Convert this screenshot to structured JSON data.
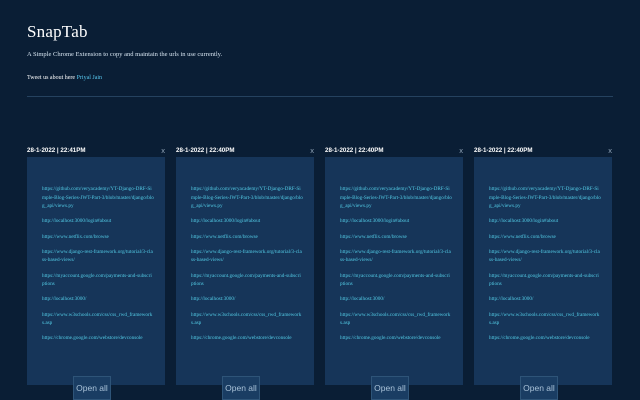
{
  "app": {
    "title": "SnapTab",
    "subtitle": "A Simple Chrome Extension to copy and maintain the urls in use currently.",
    "tweet_prefix": "Tweet us about here",
    "tweet_link": "Priyal Jain"
  },
  "colors": {
    "background": "#0a1e35",
    "card": "#163559",
    "link": "#53cce6"
  },
  "cards": [
    {
      "date": "28-1-2022 | 22:41PM",
      "close_label": "x",
      "open_all_label": "Open all",
      "urls": [
        "https://github.com/veryacademy/YT-Django-DRF-Simple-Blog-Series-JWT-Part-3/blob/master/django/blog_api/views.py",
        "http://localhost:3000/login#about",
        "https://www.netflix.com/browse",
        "https://www.django-rest-framework.org/tutorial/3-class-based-views/",
        "https://myaccount.google.com/payments-and-subscriptions",
        "http://localhost:3000/",
        "https://www.w3schools.com/css/css_rwd_frameworks.asp",
        "https://chrome.google.com/webstore/devconsole"
      ]
    },
    {
      "date": "28-1-2022 | 22:40PM",
      "close_label": "x",
      "open_all_label": "Open all",
      "urls": [
        "https://github.com/veryacademy/YT-Django-DRF-Simple-Blog-Series-JWT-Part-3/blob/master/django/blog_api/views.py",
        "http://localhost:3000/login#about",
        "https://www.netflix.com/browse",
        "https://www.django-rest-framework.org/tutorial/3-class-based-views/",
        "https://myaccount.google.com/payments-and-subscriptions",
        "http://localhost:3000/",
        "https://www.w3schools.com/css/css_rwd_frameworks.asp",
        "https://chrome.google.com/webstore/devconsole"
      ]
    },
    {
      "date": "28-1-2022 | 22:40PM",
      "close_label": "x",
      "open_all_label": "Open all",
      "urls": [
        "https://github.com/veryacademy/YT-Django-DRF-Simple-Blog-Series-JWT-Part-3/blob/master/django/blog_api/views.py",
        "http://localhost:3000/login#about",
        "https://www.netflix.com/browse",
        "https://www.django-rest-framework.org/tutorial/3-class-based-views/",
        "https://myaccount.google.com/payments-and-subscriptions",
        "http://localhost:3000/",
        "https://www.w3schools.com/css/css_rwd_frameworks.asp",
        "https://chrome.google.com/webstore/devconsole"
      ]
    },
    {
      "date": "28-1-2022 | 22:40PM",
      "close_label": "x",
      "open_all_label": "Open all",
      "urls": [
        "https://github.com/veryacademy/YT-Django-DRF-Simple-Blog-Series-JWT-Part-3/blob/master/django/blog_api/views.py",
        "http://localhost:3000/login#about",
        "https://www.netflix.com/browse",
        "https://www.django-rest-framework.org/tutorial/3-class-based-views/",
        "https://myaccount.google.com/payments-and-subscriptions",
        "http://localhost:3000/",
        "https://www.w3schools.com/css/css_rwd_frameworks.asp",
        "https://chrome.google.com/webstore/devconsole"
      ]
    }
  ]
}
